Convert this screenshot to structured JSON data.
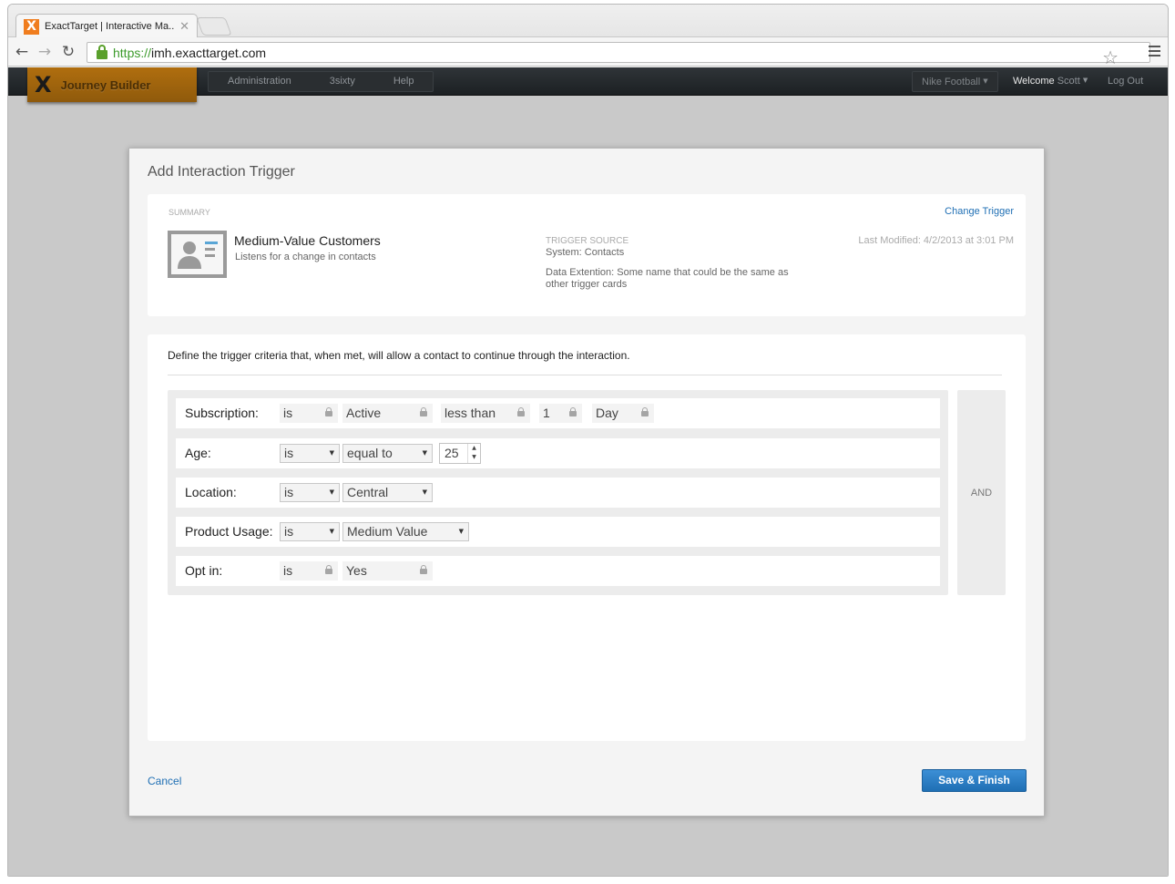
{
  "browser": {
    "tab_title": "ExactTarget | Interactive Ma..",
    "url_scheme": "https://",
    "url_host": "imh.exacttarget.com"
  },
  "app": {
    "brand_name": "Journey Builder",
    "nav_items": [
      "Administration",
      "3sixty",
      "Help"
    ],
    "org_selector": "Nike Football",
    "welcome_label": "Welcome",
    "user_name": "Scott",
    "logout_label": "Log Out"
  },
  "modal": {
    "title": "Add Interaction Trigger",
    "summary": {
      "section_label": "SUMMARY",
      "change_trigger_label": "Change Trigger",
      "trigger_name": "Medium-Value Customers",
      "trigger_description": "Listens for a change in contacts",
      "source_label": "TRIGGER SOURCE",
      "source_value": "System: Contacts",
      "data_extension": "Data Extention: Some name that could be the same as other trigger cards",
      "last_modified": "Last Modified: 4/2/2013 at 3:01 PM"
    },
    "criteria": {
      "intro": "Define the trigger criteria that, when met, will allow a contact to continue through the interaction.",
      "combinator": "AND",
      "rows": [
        {
          "label": "Subscription:",
          "operator": "is",
          "value": "Active",
          "comparison": "less than",
          "amount": "1",
          "unit": "Day"
        },
        {
          "label": "Age:",
          "operator": "is",
          "comparison": "equal to",
          "amount": "25"
        },
        {
          "label": "Location:",
          "operator": "is",
          "value": "Central"
        },
        {
          "label": "Product Usage:",
          "operator": "is",
          "value": "Medium Value"
        },
        {
          "label": "Opt in:",
          "operator": "is",
          "value": "Yes"
        }
      ]
    },
    "cancel_label": "Cancel",
    "save_label": "Save & Finish"
  }
}
